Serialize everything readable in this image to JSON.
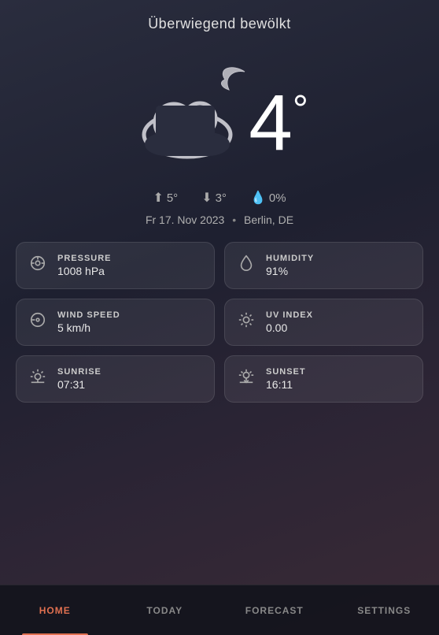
{
  "header": {
    "title": "Überwiegend bewölkt"
  },
  "temperature": {
    "value": "4",
    "unit": "°"
  },
  "stats": {
    "high_icon": "↑",
    "high_value": "5°",
    "low_icon": "↓",
    "low_value": "3°",
    "rain_icon": "💧",
    "rain_value": "0%"
  },
  "date_location": {
    "date": "Fr 17. Nov 2023",
    "separator": "•",
    "location": "Berlin, DE"
  },
  "cards": [
    {
      "id": "pressure",
      "label": "PRESSURE",
      "value": "1008 hPa",
      "icon": "gauge"
    },
    {
      "id": "humidity",
      "label": "HUMIDITY",
      "value": "91%",
      "icon": "drop"
    },
    {
      "id": "wind_speed",
      "label": "WIND SPEED",
      "value": "5 km/h",
      "icon": "wind"
    },
    {
      "id": "uv_index",
      "label": "UV INDEX",
      "value": "0.00",
      "icon": "sun"
    },
    {
      "id": "sunrise",
      "label": "SUNRISE",
      "value": "07:31",
      "icon": "sunrise"
    },
    {
      "id": "sunset",
      "label": "SUNSET",
      "value": "16:11",
      "icon": "sunset"
    }
  ],
  "nav": {
    "items": [
      {
        "id": "home",
        "label": "HOME",
        "active": true
      },
      {
        "id": "today",
        "label": "TODAY",
        "active": false
      },
      {
        "id": "forecast",
        "label": "FORECAST",
        "active": false
      },
      {
        "id": "settings",
        "label": "SETTINGS",
        "active": false
      }
    ]
  }
}
